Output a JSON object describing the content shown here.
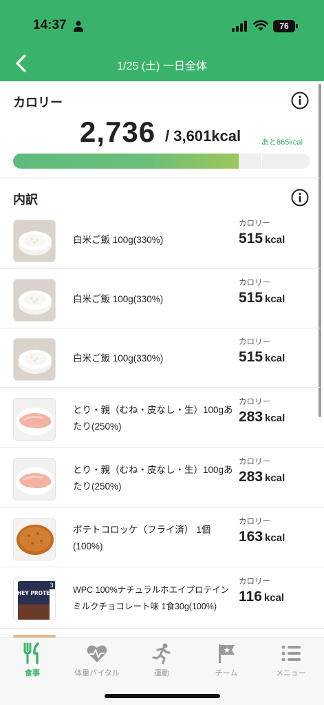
{
  "status_bar": {
    "time": "14:37",
    "battery": "76"
  },
  "header": {
    "title": "1/25 (土) 一日全体"
  },
  "calories": {
    "section_title": "カロリー",
    "consumed": "2,736",
    "goal": "/ 3,601kcal",
    "remaining": "あと865kcal",
    "progress_fraction": 0.76
  },
  "breakdown": {
    "section_title": "内訳",
    "items": [
      {
        "name": "白米ご飯 100g(330%)",
        "cal_label": "カロリー",
        "cal_value": "515",
        "cal_unit": "kcal",
        "thumb": "rice"
      },
      {
        "name": "白米ご飯 100g(330%)",
        "cal_label": "カロリー",
        "cal_value": "515",
        "cal_unit": "kcal",
        "thumb": "rice"
      },
      {
        "name": "白米ご飯 100g(330%)",
        "cal_label": "カロリー",
        "cal_value": "515",
        "cal_unit": "kcal",
        "thumb": "rice"
      },
      {
        "name": "とり・親（むね・皮なし・生）100gあたり(250%)",
        "cal_label": "カロリー",
        "cal_value": "283",
        "cal_unit": "kcal",
        "thumb": "chicken"
      },
      {
        "name": "とり・親（むね・皮なし・生）100gあたり(250%)",
        "cal_label": "カロリー",
        "cal_value": "283",
        "cal_unit": "kcal",
        "thumb": "chicken"
      },
      {
        "name": "ポテトコロッケ（フライ済） 1個(100%)",
        "cal_label": "カロリー",
        "cal_value": "163",
        "cal_unit": "kcal",
        "thumb": "croquette"
      },
      {
        "name": "WPC 100%ナチュラルホエイプロテイン ミルクチョコレート味 1食30g(100%)",
        "cal_label": "カロリー",
        "cal_value": "116",
        "cal_unit": "kcal",
        "thumb": "protein"
      }
    ],
    "protein_pack_text": "WHEY PROTEIN",
    "protein_pack_badge": "3"
  },
  "tabbar": {
    "tabs": [
      {
        "label": "食事",
        "icon": "fork-knife-icon",
        "active": true
      },
      {
        "label": "体重バイタル",
        "icon": "heart-vital-icon",
        "active": false
      },
      {
        "label": "運動",
        "icon": "runner-icon",
        "active": false
      },
      {
        "label": "チーム",
        "icon": "flag-icon",
        "active": false
      },
      {
        "label": "メニュー",
        "icon": "menu-list-icon",
        "active": false
      }
    ]
  },
  "colors": {
    "brand_green": "#39b36b",
    "text_dark": "#222222"
  }
}
